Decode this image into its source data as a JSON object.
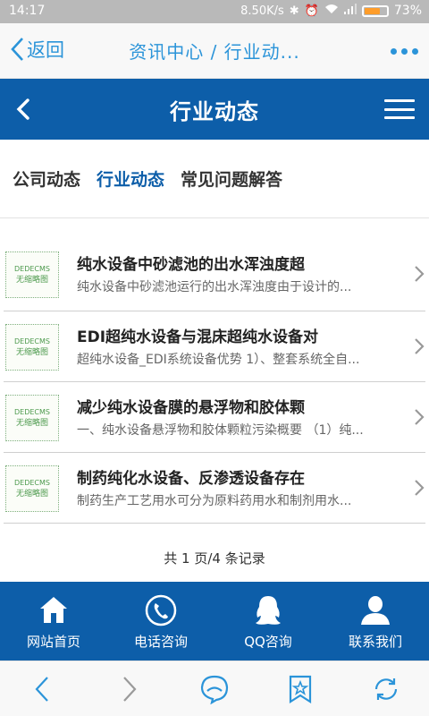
{
  "status_bar": {
    "time": "14:17",
    "speed": "8.50K/s",
    "battery_percent": "73%",
    "battery_level": 0.73
  },
  "browser": {
    "back_label": "返回",
    "title": "资讯中心 / 行业动..."
  },
  "site_header": {
    "title": "行业动态"
  },
  "tabs": [
    {
      "label": "公司动态",
      "active": false
    },
    {
      "label": "行业动态",
      "active": true
    },
    {
      "label": "常见问题解答",
      "active": false
    }
  ],
  "thumb": {
    "line1": "DEDECMS",
    "line2": "无缩略图"
  },
  "articles": [
    {
      "title": "纯水设备中砂滤池的出水浑浊度超",
      "desc": "纯水设备中砂滤池运行的出水浑浊度由于设计的..."
    },
    {
      "title": "EDI超纯水设备与混床超纯水设备对",
      "desc": "超纯水设备_EDI系统设备优势 1）、整套系统全自..."
    },
    {
      "title": "减少纯水设备膜的悬浮物和胶体颗",
      "desc": "一、纯水设备悬浮物和胶体颗粒污染概要 （1）纯..."
    },
    {
      "title": "制药纯化水设备、反渗透设备存在",
      "desc": "制药生产工艺用水可分为原料药用水和制剂用水..."
    }
  ],
  "pager": "共 1 页/4 条记录",
  "site_nav": [
    {
      "label": "网站首页",
      "icon": "home-icon"
    },
    {
      "label": "电话咨询",
      "icon": "phone-icon"
    },
    {
      "label": "QQ咨询",
      "icon": "qq-icon"
    },
    {
      "label": "联系我们",
      "icon": "user-icon"
    }
  ],
  "colors": {
    "brand_blue": "#0d5ea9",
    "link_blue": "#2b94d9",
    "status_gray": "#b9b9b9",
    "battery_orange": "#ff9d2a"
  }
}
